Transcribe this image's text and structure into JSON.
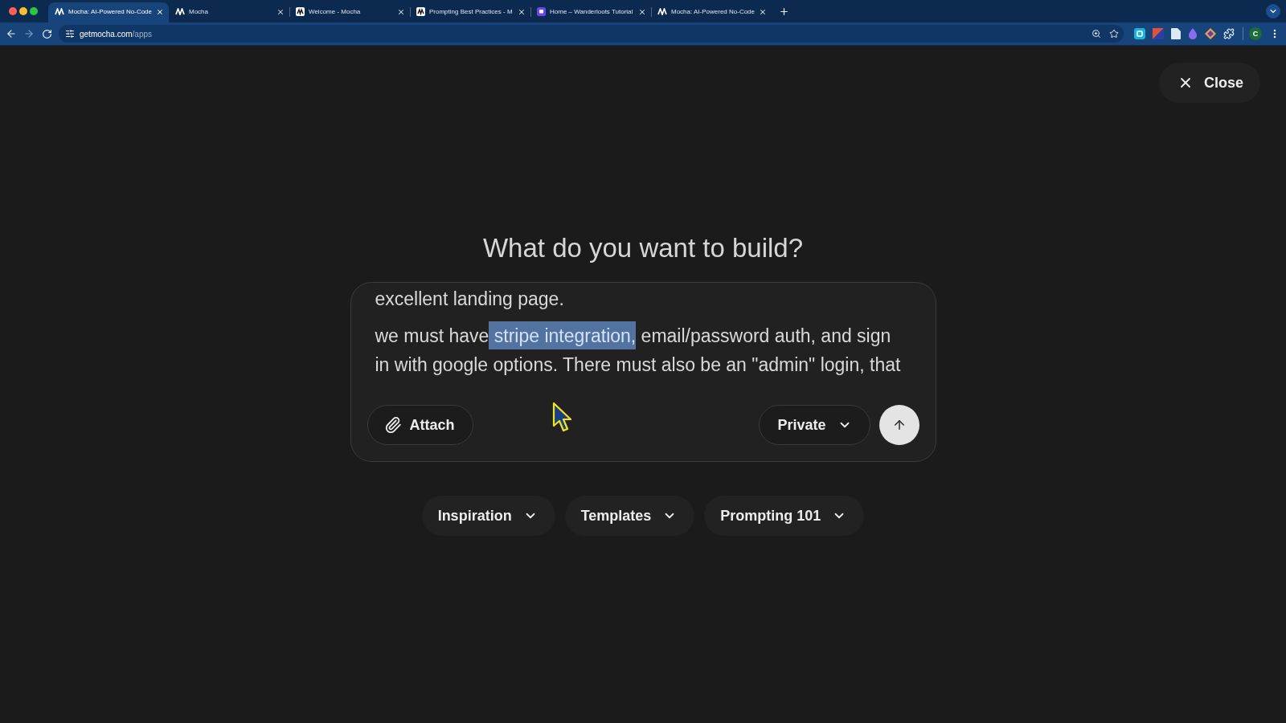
{
  "browser": {
    "tabs": [
      {
        "title": "Mocha: AI-Powered No-Code",
        "kind": "mocha",
        "selected": true
      },
      {
        "title": "Mocha",
        "kind": "mocha",
        "selected": false
      },
      {
        "title": "Welcome - Mocha",
        "kind": "mocha-tile",
        "selected": false
      },
      {
        "title": "Prompting Best Practices - M",
        "kind": "mocha-tile",
        "selected": false
      },
      {
        "title": "Home – Wanderloots Tutorial",
        "kind": "app-tile",
        "selected": false
      },
      {
        "title": "Mocha: AI-Powered No-Code",
        "kind": "mocha",
        "selected": false
      }
    ],
    "address": {
      "host": "getmocha.com",
      "path": "/apps"
    },
    "profile_initial": "C"
  },
  "close_button": {
    "label": "Close"
  },
  "heading": "What do you want to build?",
  "prompt": {
    "paragraphs": [
      {
        "segments": [
          {
            "text": "excellent landing page.",
            "selected": false
          }
        ]
      },
      {
        "segments": [
          {
            "text": "we must have",
            "selected": false
          },
          {
            "text": " stripe integration,",
            "selected": true
          },
          {
            "text": " email/password auth, and sign in with google options. There must also be an \"admin\" login, that",
            "selected": false
          }
        ]
      }
    ]
  },
  "attach_button": {
    "label": "Attach"
  },
  "visibility_select": {
    "value": "Private"
  },
  "menus": [
    {
      "label": "Inspiration"
    },
    {
      "label": "Templates"
    },
    {
      "label": "Prompting 101"
    }
  ]
}
